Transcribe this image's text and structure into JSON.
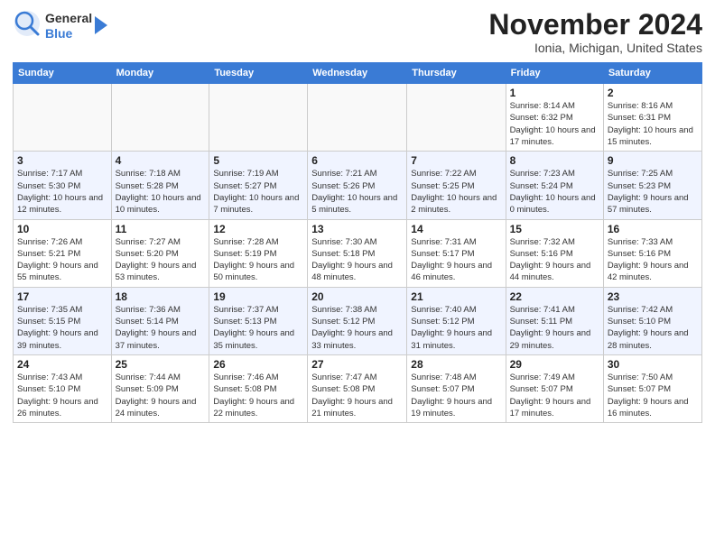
{
  "header": {
    "logo_general": "General",
    "logo_blue": "Blue",
    "title": "November 2024",
    "location": "Ionia, Michigan, United States"
  },
  "columns": [
    "Sunday",
    "Monday",
    "Tuesday",
    "Wednesday",
    "Thursday",
    "Friday",
    "Saturday"
  ],
  "weeks": [
    {
      "days": [
        {
          "num": "",
          "info": ""
        },
        {
          "num": "",
          "info": ""
        },
        {
          "num": "",
          "info": ""
        },
        {
          "num": "",
          "info": ""
        },
        {
          "num": "",
          "info": ""
        },
        {
          "num": "1",
          "info": "Sunrise: 8:14 AM\nSunset: 6:32 PM\nDaylight: 10 hours\nand 17 minutes."
        },
        {
          "num": "2",
          "info": "Sunrise: 8:16 AM\nSunset: 6:31 PM\nDaylight: 10 hours\nand 15 minutes."
        }
      ]
    },
    {
      "days": [
        {
          "num": "3",
          "info": "Sunrise: 7:17 AM\nSunset: 5:30 PM\nDaylight: 10 hours\nand 12 minutes."
        },
        {
          "num": "4",
          "info": "Sunrise: 7:18 AM\nSunset: 5:28 PM\nDaylight: 10 hours\nand 10 minutes."
        },
        {
          "num": "5",
          "info": "Sunrise: 7:19 AM\nSunset: 5:27 PM\nDaylight: 10 hours\nand 7 minutes."
        },
        {
          "num": "6",
          "info": "Sunrise: 7:21 AM\nSunset: 5:26 PM\nDaylight: 10 hours\nand 5 minutes."
        },
        {
          "num": "7",
          "info": "Sunrise: 7:22 AM\nSunset: 5:25 PM\nDaylight: 10 hours\nand 2 minutes."
        },
        {
          "num": "8",
          "info": "Sunrise: 7:23 AM\nSunset: 5:24 PM\nDaylight: 10 hours\nand 0 minutes."
        },
        {
          "num": "9",
          "info": "Sunrise: 7:25 AM\nSunset: 5:23 PM\nDaylight: 9 hours\nand 57 minutes."
        }
      ]
    },
    {
      "days": [
        {
          "num": "10",
          "info": "Sunrise: 7:26 AM\nSunset: 5:21 PM\nDaylight: 9 hours\nand 55 minutes."
        },
        {
          "num": "11",
          "info": "Sunrise: 7:27 AM\nSunset: 5:20 PM\nDaylight: 9 hours\nand 53 minutes."
        },
        {
          "num": "12",
          "info": "Sunrise: 7:28 AM\nSunset: 5:19 PM\nDaylight: 9 hours\nand 50 minutes."
        },
        {
          "num": "13",
          "info": "Sunrise: 7:30 AM\nSunset: 5:18 PM\nDaylight: 9 hours\nand 48 minutes."
        },
        {
          "num": "14",
          "info": "Sunrise: 7:31 AM\nSunset: 5:17 PM\nDaylight: 9 hours\nand 46 minutes."
        },
        {
          "num": "15",
          "info": "Sunrise: 7:32 AM\nSunset: 5:16 PM\nDaylight: 9 hours\nand 44 minutes."
        },
        {
          "num": "16",
          "info": "Sunrise: 7:33 AM\nSunset: 5:16 PM\nDaylight: 9 hours\nand 42 minutes."
        }
      ]
    },
    {
      "days": [
        {
          "num": "17",
          "info": "Sunrise: 7:35 AM\nSunset: 5:15 PM\nDaylight: 9 hours\nand 39 minutes."
        },
        {
          "num": "18",
          "info": "Sunrise: 7:36 AM\nSunset: 5:14 PM\nDaylight: 9 hours\nand 37 minutes."
        },
        {
          "num": "19",
          "info": "Sunrise: 7:37 AM\nSunset: 5:13 PM\nDaylight: 9 hours\nand 35 minutes."
        },
        {
          "num": "20",
          "info": "Sunrise: 7:38 AM\nSunset: 5:12 PM\nDaylight: 9 hours\nand 33 minutes."
        },
        {
          "num": "21",
          "info": "Sunrise: 7:40 AM\nSunset: 5:12 PM\nDaylight: 9 hours\nand 31 minutes."
        },
        {
          "num": "22",
          "info": "Sunrise: 7:41 AM\nSunset: 5:11 PM\nDaylight: 9 hours\nand 29 minutes."
        },
        {
          "num": "23",
          "info": "Sunrise: 7:42 AM\nSunset: 5:10 PM\nDaylight: 9 hours\nand 28 minutes."
        }
      ]
    },
    {
      "days": [
        {
          "num": "24",
          "info": "Sunrise: 7:43 AM\nSunset: 5:10 PM\nDaylight: 9 hours\nand 26 minutes."
        },
        {
          "num": "25",
          "info": "Sunrise: 7:44 AM\nSunset: 5:09 PM\nDaylight: 9 hours\nand 24 minutes."
        },
        {
          "num": "26",
          "info": "Sunrise: 7:46 AM\nSunset: 5:08 PM\nDaylight: 9 hours\nand 22 minutes."
        },
        {
          "num": "27",
          "info": "Sunrise: 7:47 AM\nSunset: 5:08 PM\nDaylight: 9 hours\nand 21 minutes."
        },
        {
          "num": "28",
          "info": "Sunrise: 7:48 AM\nSunset: 5:07 PM\nDaylight: 9 hours\nand 19 minutes."
        },
        {
          "num": "29",
          "info": "Sunrise: 7:49 AM\nSunset: 5:07 PM\nDaylight: 9 hours\nand 17 minutes."
        },
        {
          "num": "30",
          "info": "Sunrise: 7:50 AM\nSunset: 5:07 PM\nDaylight: 9 hours\nand 16 minutes."
        }
      ]
    }
  ]
}
